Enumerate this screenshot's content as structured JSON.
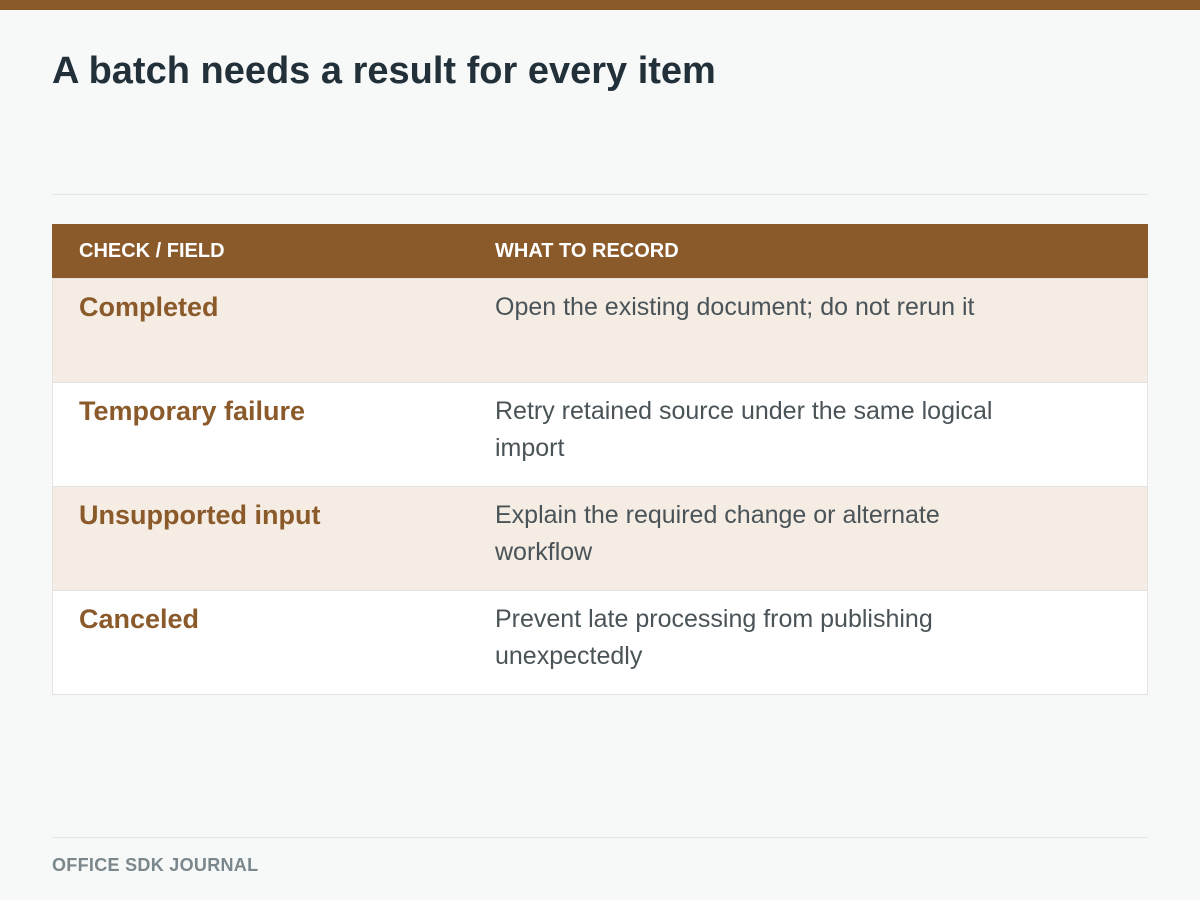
{
  "page": {
    "title": "A batch needs a result for every item",
    "footer": "OFFICE SDK JOURNAL"
  },
  "table": {
    "headers": [
      "CHECK / FIELD",
      "WHAT TO RECORD"
    ],
    "rows": [
      {
        "check": "Completed",
        "record": "Open the existing document; do not rerun it"
      },
      {
        "check": "Temporary failure",
        "record": "Retry retained source under the same logical import"
      },
      {
        "check": "Unsupported input",
        "record": "Explain the required change or alternate workflow"
      },
      {
        "check": "Canceled",
        "record": "Prevent late processing from publishing unexpectedly"
      }
    ]
  },
  "colors": {
    "accent": "#8b5a2b",
    "shaded_row": "#f5ece4",
    "background": "#f7f8f8"
  }
}
